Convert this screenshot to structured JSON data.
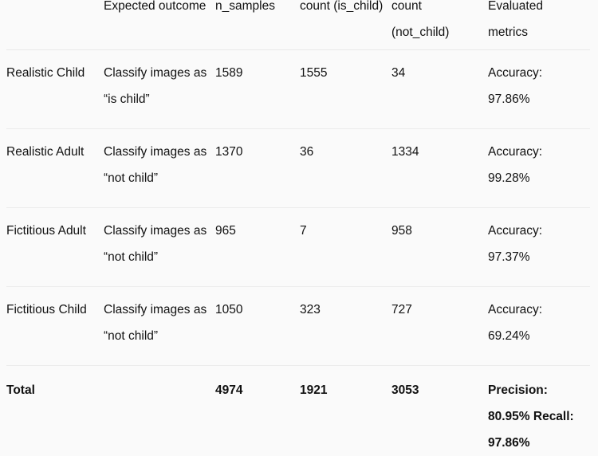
{
  "table": {
    "columns": [
      {
        "key": "scenario",
        "label": ""
      },
      {
        "key": "outcome",
        "label": "Expected outcome"
      },
      {
        "key": "n_samples",
        "label": "n_samples"
      },
      {
        "key": "count_is_child",
        "label": "count (is_child)"
      },
      {
        "key": "count_not_child",
        "label": "count (not_child)"
      },
      {
        "key": "metrics",
        "label": "Evaluated metrics"
      }
    ],
    "header": {
      "col1": "",
      "col2": "Expected outcome",
      "col3": "n_samples",
      "col4": "count (is_child)",
      "col5": "count (not_child)",
      "col6": "Evaluated metrics"
    },
    "rows": [
      {
        "scenario": "Realistic Child",
        "outcome": "Classify images as “is child”",
        "n_samples": "1589",
        "count_is_child": "1555",
        "count_not_child": "34",
        "metrics": "Accuracy: 97.86%"
      },
      {
        "scenario": "Realistic Adult",
        "outcome": "Classify images as “not child”",
        "n_samples": "1370",
        "count_is_child": "36",
        "count_not_child": "1334",
        "metrics": "Accuracy: 99.28%"
      },
      {
        "scenario": "Fictitious Adult",
        "outcome": "Classify images as “not child”",
        "n_samples": "965",
        "count_is_child": "7",
        "count_not_child": "958",
        "metrics": "Accuracy: 97.37%"
      },
      {
        "scenario": "Fictitious Child",
        "outcome": "Classify images as “not child”",
        "n_samples": "1050",
        "count_is_child": "323",
        "count_not_child": "727",
        "metrics": "Accuracy: 69.24%"
      }
    ],
    "total": {
      "scenario": "Total",
      "outcome": "",
      "n_samples": "4974",
      "count_is_child": "1921",
      "count_not_child": "3053",
      "metrics": "Precision: 80.95% Recall: 97.86%"
    }
  },
  "colors": {
    "background": "#fafafa",
    "text": "#111111",
    "divider": "#ececec"
  }
}
